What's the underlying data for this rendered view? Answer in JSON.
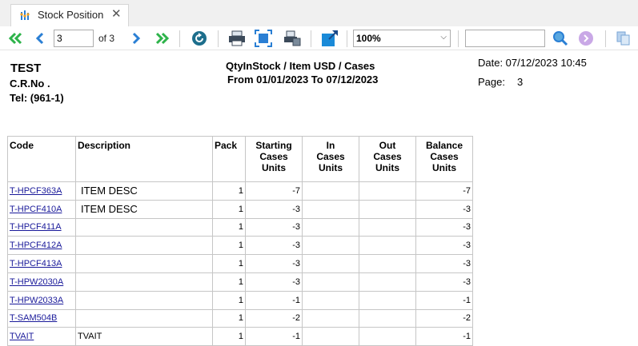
{
  "tab": {
    "title": "Stock Position",
    "close": "✕"
  },
  "toolbar": {
    "page_value": "3",
    "page_of": "of 3",
    "zoom_value": "100%",
    "zoom_arrow": "⌵",
    "search_placeholder": ""
  },
  "report": {
    "company": "TEST",
    "cr_no": "C.R.No .",
    "tel": "Tel: (961-1)",
    "title": "QtyInStock / Item USD / Cases",
    "period": "From 01/01/2023  To 07/12/2023",
    "date": "Date: 07/12/2023 10:45",
    "page_label": "Page:",
    "page_number": "3"
  },
  "table": {
    "headers": {
      "code": "Code",
      "description": "Description",
      "pack": "Pack",
      "starting_l1": "Starting",
      "starting_l2": "Cases",
      "starting_l3": "Units",
      "in_l1": "In",
      "in_l2": "Cases",
      "in_l3": "Units",
      "out_l1": "Out",
      "out_l2": "Cases",
      "out_l3": "Units",
      "balance_l1": "Balance",
      "balance_l2": "Cases",
      "balance_l3": "Units"
    },
    "rows": [
      {
        "code": "T-HPCF363A",
        "description": "ITEM DESC",
        "pack": "1",
        "starting": "-7",
        "in": "",
        "out": "",
        "balance": "-7"
      },
      {
        "code": "T-HPCF410A",
        "description": "ITEM DESC",
        "pack": "1",
        "starting": "-3",
        "in": "",
        "out": "",
        "balance": "-3"
      },
      {
        "code": "T-HPCF411A",
        "description": "",
        "pack": "1",
        "starting": "-3",
        "in": "",
        "out": "",
        "balance": "-3"
      },
      {
        "code": "T-HPCF412A",
        "description": "",
        "pack": "1",
        "starting": "-3",
        "in": "",
        "out": "",
        "balance": "-3"
      },
      {
        "code": "T-HPCF413A",
        "description": "",
        "pack": "1",
        "starting": "-3",
        "in": "",
        "out": "",
        "balance": "-3"
      },
      {
        "code": "T-HPW2030A",
        "description": "",
        "pack": "1",
        "starting": "-3",
        "in": "",
        "out": "",
        "balance": "-3"
      },
      {
        "code": "T-HPW2033A",
        "description": "",
        "pack": "1",
        "starting": "-1",
        "in": "",
        "out": "",
        "balance": "-1"
      },
      {
        "code": "T-SAM504B",
        "description": "",
        "pack": "1",
        "starting": "-2",
        "in": "",
        "out": "",
        "balance": "-2"
      },
      {
        "code": "TVAIT",
        "description": "TVAIT",
        "pack": "1",
        "starting": "-1",
        "in": "",
        "out": "",
        "balance": "-1"
      }
    ]
  },
  "colors": {
    "nav_first_last": "#2db34a",
    "nav_prev_next": "#2a7fd4",
    "refresh": "#1d6e8c",
    "tab_bg": "#f0f0f0"
  },
  "icons": [
    "stock-chart-icon",
    "first-page-icon",
    "previous-page-icon",
    "next-page-icon",
    "last-page-icon",
    "refresh-icon",
    "print-icon",
    "fit-page-icon",
    "print-setup-icon",
    "export-icon",
    "search-icon",
    "find-next-icon",
    "copy-icon"
  ]
}
